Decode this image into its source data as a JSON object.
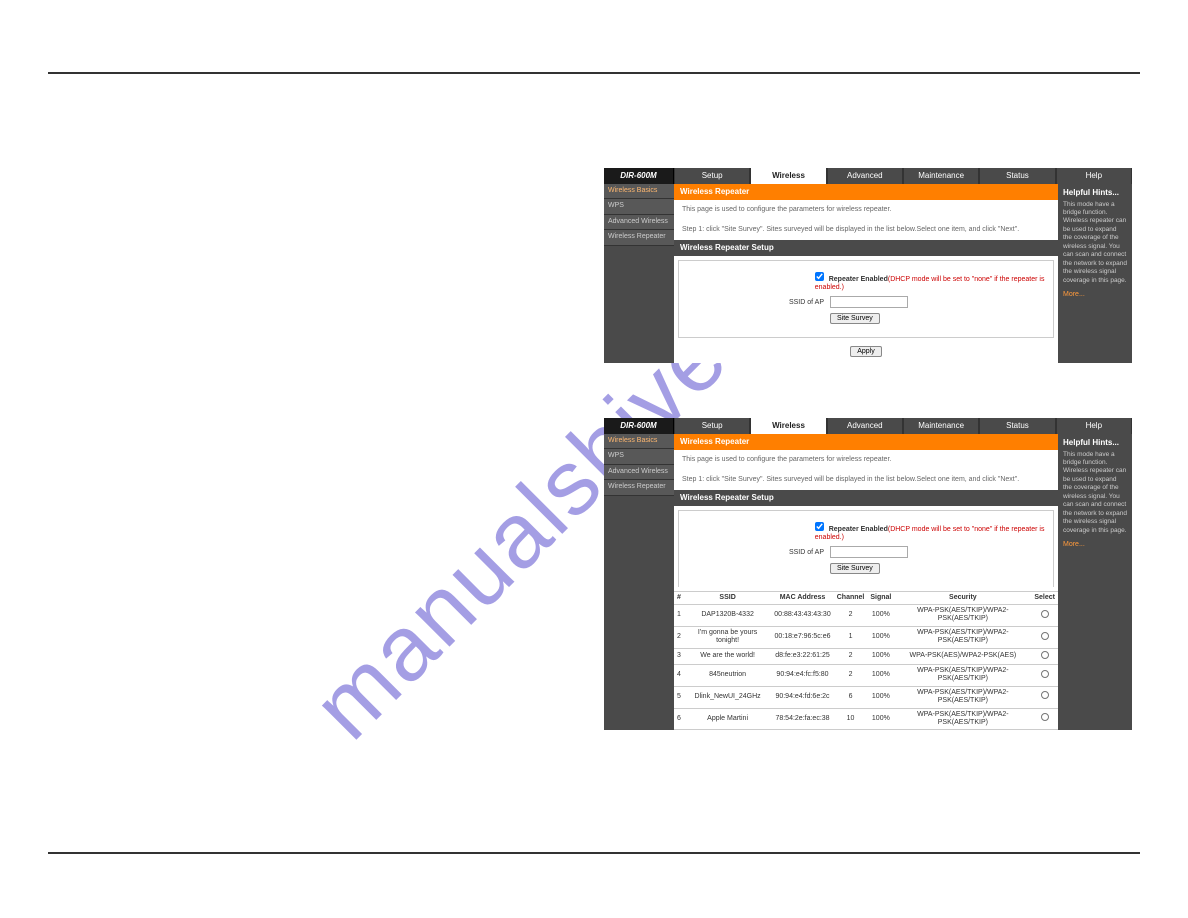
{
  "watermark": "manualshive.com",
  "router": {
    "model": "DIR-600M",
    "tabs": [
      "Setup",
      "Wireless",
      "Advanced",
      "Maintenance",
      "Status",
      "Help"
    ],
    "activeTab": "Wireless",
    "side": [
      "Wireless Basics",
      "WPS",
      "Advanced Wireless",
      "Wireless Repeater"
    ],
    "sideActiveR1": "Wireless Basics",
    "sideActiveR2": "Wireless Basics",
    "heading": "Wireless Repeater",
    "info1": "This page is used to configure the parameters for wireless repeater.",
    "info2": "Step 1: click \"Site Survey\". Sites surveyed will be displayed in the list below.Select one item, and click \"Next\".",
    "setupHeading": "Wireless Repeater Setup",
    "repeaterLabel": "Repeater Enabled",
    "repeaterWarn": "(DHCP mode will be set to \"none\" if the repeater is enabled.)",
    "ssidLabel": "SSID of AP",
    "siteSurveyBtn": "Site Survey",
    "applyBtn": "Apply",
    "hintsTitle": "Helpful Hints...",
    "hintsText": "This mode have a bridge function. Wireless repeater can be used to expand the coverage of the wireless signal. You can scan and connect the network to expand the wireless signal coverage in this page.",
    "hintsMore": "More...",
    "tableHeaders": [
      "#",
      "SSID",
      "MAC Address",
      "Channel",
      "Signal",
      "Security",
      "Select"
    ],
    "rows": [
      {
        "n": "1",
        "ssid": "DAP1320B-4332",
        "mac": "00:88:43:43:43:30",
        "ch": "2",
        "sig": "100%",
        "sec": "WPA-PSK(AES/TKIP)/WPA2-PSK(AES/TKIP)"
      },
      {
        "n": "2",
        "ssid": "I'm gonna be yours tonight!",
        "mac": "00:18:e7:96:5c:e6",
        "ch": "1",
        "sig": "100%",
        "sec": "WPA-PSK(AES/TKIP)/WPA2-PSK(AES/TKIP)"
      },
      {
        "n": "3",
        "ssid": "We are the world!",
        "mac": "d8:fe:e3:22:61:25",
        "ch": "2",
        "sig": "100%",
        "sec": "WPA-PSK(AES)/WPA2-PSK(AES)"
      },
      {
        "n": "4",
        "ssid": "845neutrion",
        "mac": "90:94:e4:fc:f5:80",
        "ch": "2",
        "sig": "100%",
        "sec": "WPA-PSK(AES/TKIP)/WPA2-PSK(AES/TKIP)"
      },
      {
        "n": "5",
        "ssid": "Dlink_NewUI_24GHz",
        "mac": "90:94:e4:fd:6e:2c",
        "ch": "6",
        "sig": "100%",
        "sec": "WPA-PSK(AES/TKIP)/WPA2-PSK(AES/TKIP)"
      },
      {
        "n": "6",
        "ssid": "Apple Martini",
        "mac": "78:54:2e:fa:ec:38",
        "ch": "10",
        "sig": "100%",
        "sec": "WPA-PSK(AES/TKIP)/WPA2-PSK(AES/TKIP)"
      }
    ]
  }
}
